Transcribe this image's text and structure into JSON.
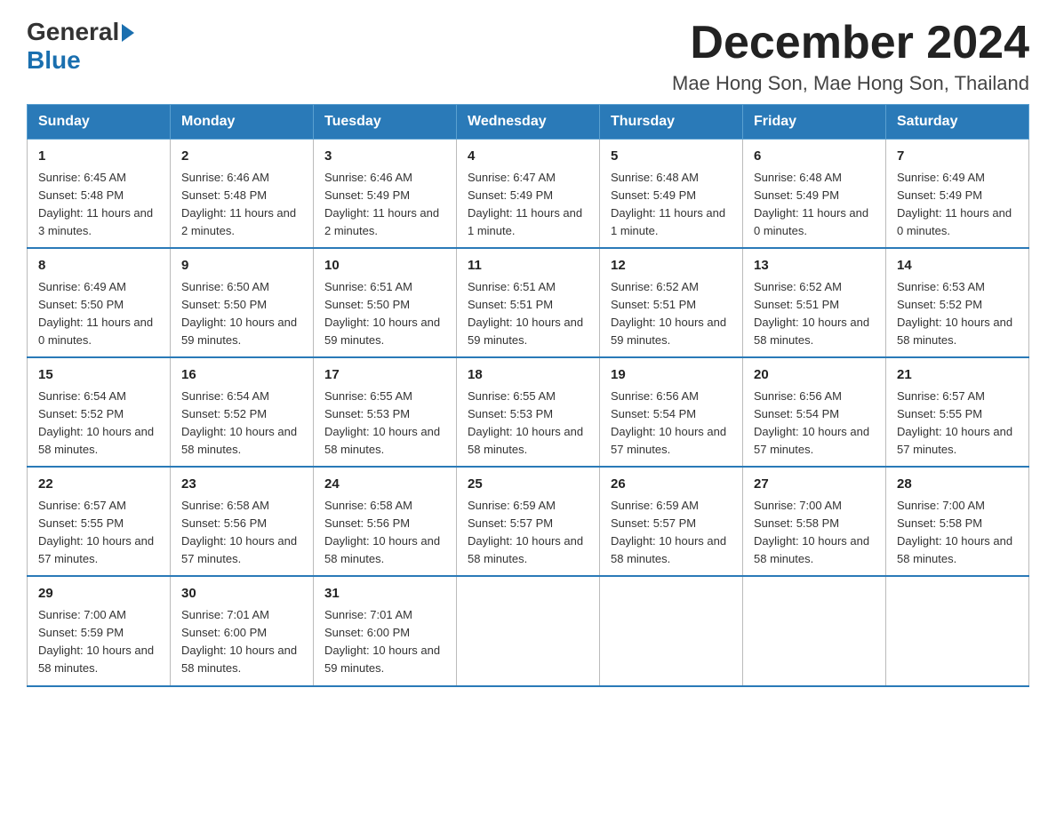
{
  "logo": {
    "general": "General",
    "blue": "Blue",
    "arrow": "▶"
  },
  "title": {
    "month_year": "December 2024",
    "location": "Mae Hong Son, Mae Hong Son, Thailand"
  },
  "headers": [
    "Sunday",
    "Monday",
    "Tuesday",
    "Wednesday",
    "Thursday",
    "Friday",
    "Saturday"
  ],
  "weeks": [
    [
      {
        "day": "1",
        "sunrise": "Sunrise: 6:45 AM",
        "sunset": "Sunset: 5:48 PM",
        "daylight": "Daylight: 11 hours and 3 minutes."
      },
      {
        "day": "2",
        "sunrise": "Sunrise: 6:46 AM",
        "sunset": "Sunset: 5:48 PM",
        "daylight": "Daylight: 11 hours and 2 minutes."
      },
      {
        "day": "3",
        "sunrise": "Sunrise: 6:46 AM",
        "sunset": "Sunset: 5:49 PM",
        "daylight": "Daylight: 11 hours and 2 minutes."
      },
      {
        "day": "4",
        "sunrise": "Sunrise: 6:47 AM",
        "sunset": "Sunset: 5:49 PM",
        "daylight": "Daylight: 11 hours and 1 minute."
      },
      {
        "day": "5",
        "sunrise": "Sunrise: 6:48 AM",
        "sunset": "Sunset: 5:49 PM",
        "daylight": "Daylight: 11 hours and 1 minute."
      },
      {
        "day": "6",
        "sunrise": "Sunrise: 6:48 AM",
        "sunset": "Sunset: 5:49 PM",
        "daylight": "Daylight: 11 hours and 0 minutes."
      },
      {
        "day": "7",
        "sunrise": "Sunrise: 6:49 AM",
        "sunset": "Sunset: 5:49 PM",
        "daylight": "Daylight: 11 hours and 0 minutes."
      }
    ],
    [
      {
        "day": "8",
        "sunrise": "Sunrise: 6:49 AM",
        "sunset": "Sunset: 5:50 PM",
        "daylight": "Daylight: 11 hours and 0 minutes."
      },
      {
        "day": "9",
        "sunrise": "Sunrise: 6:50 AM",
        "sunset": "Sunset: 5:50 PM",
        "daylight": "Daylight: 10 hours and 59 minutes."
      },
      {
        "day": "10",
        "sunrise": "Sunrise: 6:51 AM",
        "sunset": "Sunset: 5:50 PM",
        "daylight": "Daylight: 10 hours and 59 minutes."
      },
      {
        "day": "11",
        "sunrise": "Sunrise: 6:51 AM",
        "sunset": "Sunset: 5:51 PM",
        "daylight": "Daylight: 10 hours and 59 minutes."
      },
      {
        "day": "12",
        "sunrise": "Sunrise: 6:52 AM",
        "sunset": "Sunset: 5:51 PM",
        "daylight": "Daylight: 10 hours and 59 minutes."
      },
      {
        "day": "13",
        "sunrise": "Sunrise: 6:52 AM",
        "sunset": "Sunset: 5:51 PM",
        "daylight": "Daylight: 10 hours and 58 minutes."
      },
      {
        "day": "14",
        "sunrise": "Sunrise: 6:53 AM",
        "sunset": "Sunset: 5:52 PM",
        "daylight": "Daylight: 10 hours and 58 minutes."
      }
    ],
    [
      {
        "day": "15",
        "sunrise": "Sunrise: 6:54 AM",
        "sunset": "Sunset: 5:52 PM",
        "daylight": "Daylight: 10 hours and 58 minutes."
      },
      {
        "day": "16",
        "sunrise": "Sunrise: 6:54 AM",
        "sunset": "Sunset: 5:52 PM",
        "daylight": "Daylight: 10 hours and 58 minutes."
      },
      {
        "day": "17",
        "sunrise": "Sunrise: 6:55 AM",
        "sunset": "Sunset: 5:53 PM",
        "daylight": "Daylight: 10 hours and 58 minutes."
      },
      {
        "day": "18",
        "sunrise": "Sunrise: 6:55 AM",
        "sunset": "Sunset: 5:53 PM",
        "daylight": "Daylight: 10 hours and 58 minutes."
      },
      {
        "day": "19",
        "sunrise": "Sunrise: 6:56 AM",
        "sunset": "Sunset: 5:54 PM",
        "daylight": "Daylight: 10 hours and 57 minutes."
      },
      {
        "day": "20",
        "sunrise": "Sunrise: 6:56 AM",
        "sunset": "Sunset: 5:54 PM",
        "daylight": "Daylight: 10 hours and 57 minutes."
      },
      {
        "day": "21",
        "sunrise": "Sunrise: 6:57 AM",
        "sunset": "Sunset: 5:55 PM",
        "daylight": "Daylight: 10 hours and 57 minutes."
      }
    ],
    [
      {
        "day": "22",
        "sunrise": "Sunrise: 6:57 AM",
        "sunset": "Sunset: 5:55 PM",
        "daylight": "Daylight: 10 hours and 57 minutes."
      },
      {
        "day": "23",
        "sunrise": "Sunrise: 6:58 AM",
        "sunset": "Sunset: 5:56 PM",
        "daylight": "Daylight: 10 hours and 57 minutes."
      },
      {
        "day": "24",
        "sunrise": "Sunrise: 6:58 AM",
        "sunset": "Sunset: 5:56 PM",
        "daylight": "Daylight: 10 hours and 58 minutes."
      },
      {
        "day": "25",
        "sunrise": "Sunrise: 6:59 AM",
        "sunset": "Sunset: 5:57 PM",
        "daylight": "Daylight: 10 hours and 58 minutes."
      },
      {
        "day": "26",
        "sunrise": "Sunrise: 6:59 AM",
        "sunset": "Sunset: 5:57 PM",
        "daylight": "Daylight: 10 hours and 58 minutes."
      },
      {
        "day": "27",
        "sunrise": "Sunrise: 7:00 AM",
        "sunset": "Sunset: 5:58 PM",
        "daylight": "Daylight: 10 hours and 58 minutes."
      },
      {
        "day": "28",
        "sunrise": "Sunrise: 7:00 AM",
        "sunset": "Sunset: 5:58 PM",
        "daylight": "Daylight: 10 hours and 58 minutes."
      }
    ],
    [
      {
        "day": "29",
        "sunrise": "Sunrise: 7:00 AM",
        "sunset": "Sunset: 5:59 PM",
        "daylight": "Daylight: 10 hours and 58 minutes."
      },
      {
        "day": "30",
        "sunrise": "Sunrise: 7:01 AM",
        "sunset": "Sunset: 6:00 PM",
        "daylight": "Daylight: 10 hours and 58 minutes."
      },
      {
        "day": "31",
        "sunrise": "Sunrise: 7:01 AM",
        "sunset": "Sunset: 6:00 PM",
        "daylight": "Daylight: 10 hours and 59 minutes."
      },
      null,
      null,
      null,
      null
    ]
  ]
}
